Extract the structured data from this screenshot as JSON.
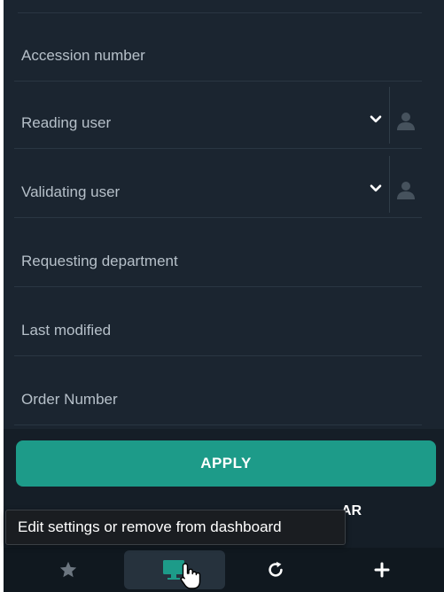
{
  "filters": [
    {
      "label": "Accession number"
    },
    {
      "label": "Reading user"
    },
    {
      "label": "Validating user"
    },
    {
      "label": "Requesting department"
    },
    {
      "label": "Last modified"
    },
    {
      "label": "Order Number"
    }
  ],
  "actions": {
    "apply_label": "APPLY",
    "clear_label_visible": "AR"
  },
  "tooltip": {
    "text": "Edit settings or remove from dashboard"
  },
  "bottom_tabs": [
    {
      "icon": "star-icon"
    },
    {
      "icon": "monitor-settings-icon",
      "active": true
    },
    {
      "icon": "refresh-icon"
    },
    {
      "icon": "plus-icon"
    }
  ],
  "colors": {
    "panel_bg": "#1b2530",
    "accent": "#1d9b89",
    "text": "#b6c0c9"
  }
}
